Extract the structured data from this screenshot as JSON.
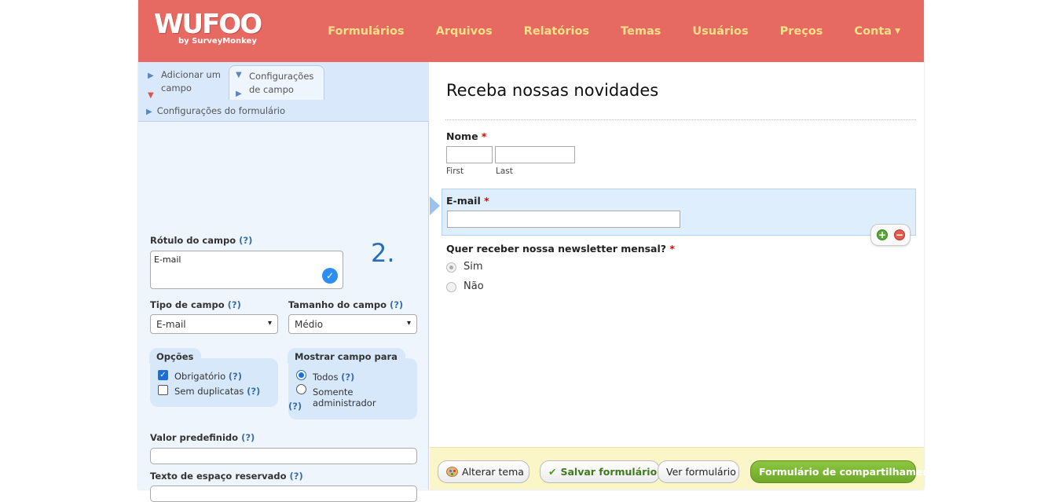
{
  "brand": {
    "logo_text": "WUFOO",
    "byline": "by SurveyMonkey"
  },
  "nav": {
    "items": [
      "Formulários",
      "Arquivos",
      "Relatórios",
      "Temas",
      "Usuários",
      "Preços"
    ],
    "account": "Conta"
  },
  "left_panel": {
    "tab_add_field": "Adicionar um campo",
    "tab_field_settings": "Configurações de campo",
    "tab_form_settings": "Configurações do formulário",
    "field_label": {
      "label": "Rótulo do campo",
      "help": "(?)",
      "value": "E-mail"
    },
    "step_marker": "2.",
    "field_type": {
      "label": "Tipo de campo",
      "help": "(?)",
      "value": "E-mail"
    },
    "field_size": {
      "label": "Tamanho do campo",
      "help": "(?)",
      "value": "Médio"
    },
    "options": {
      "legend": "Opções",
      "required_label": "Obrigatório",
      "required_checked": true,
      "no_duplicates_label": "Sem duplicatas",
      "no_duplicates_checked": false,
      "help": "(?)"
    },
    "show_field_for": {
      "legend": "Mostrar campo para",
      "all_label": "Todos",
      "admin_label": "Somente administrador",
      "selected": "Todos",
      "help": "(?)"
    },
    "default_value": {
      "label": "Valor predefinido",
      "help": "(?)",
      "value": ""
    },
    "placeholder_text": {
      "label": "Texto de espaço reservado",
      "help": "(?)"
    }
  },
  "form_preview": {
    "title": "Receba nossas novidades",
    "name_field": {
      "label": "Nome",
      "required_mark": "*",
      "first_sublabel": "First",
      "last_sublabel": "Last"
    },
    "email_field": {
      "label": "E-mail",
      "required_mark": "*"
    },
    "newsletter_field": {
      "label": "Quer receber nossa newsletter mensal?",
      "required_mark": "*",
      "options": [
        "Sim",
        "Não"
      ],
      "selected": "Sim"
    }
  },
  "toolbar": {
    "change_theme": "Alterar tema",
    "save_form": "Salvar formulário",
    "view_form": "Ver formulário",
    "share_form": "Formulário de compartilhamento"
  },
  "colors": {
    "header_bg": "#e66a62",
    "nav_text": "#f7e088",
    "panel_bg": "#eef5fd",
    "selected_row_bg": "#dfeefd",
    "toolbar_bg": "#fbf6c8",
    "share_button_green": "#7db935",
    "step_marker_blue": "#2a6db8"
  }
}
